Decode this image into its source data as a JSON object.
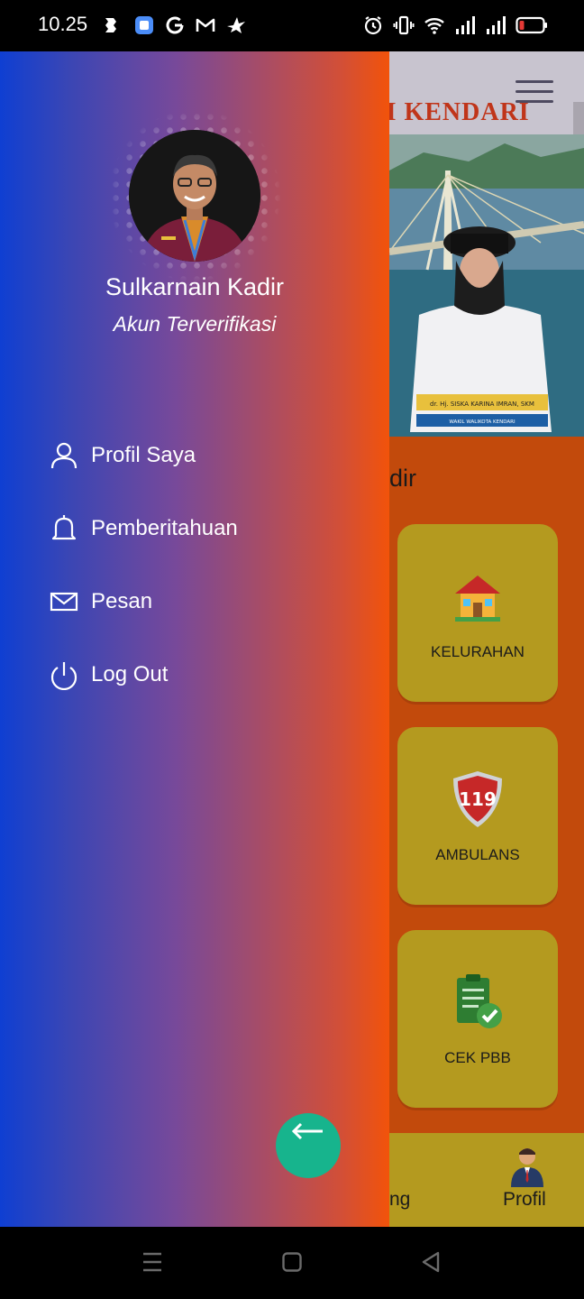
{
  "status_bar": {
    "time": "10.25",
    "left_icons": [
      "app-icon",
      "app-icon",
      "g-icon",
      "gmail-icon",
      "bird-icon"
    ],
    "right_icons": [
      "alarm-icon",
      "vibrate-icon",
      "wifi-icon",
      "signal-icon",
      "signal-icon",
      "battery-icon"
    ]
  },
  "background_app": {
    "header_title": "SI KENDARI",
    "banner_caption": "dr. Hj. SISKA KARINA IMRAN, SKM",
    "banner_subcaption": "WAKIL WALIKOTA KENDARI",
    "welcome_partial": "dir",
    "menu_cards": [
      {
        "label": "KELURAHAN",
        "icon": "house-icon"
      },
      {
        "label": "AMBULANS",
        "icon": "ambulance-119-icon"
      },
      {
        "label": "CEK PBB",
        "icon": "checklist-icon"
      }
    ],
    "bottom_nav": {
      "left_partial": "ng",
      "profile_label": "Profil"
    }
  },
  "drawer": {
    "name": "Sulkarnain Kadir",
    "status": "Akun Terverifikasi",
    "items": [
      {
        "label": "Profil Saya",
        "icon": "user-icon"
      },
      {
        "label": "Pemberitahuan",
        "icon": "bell-icon"
      },
      {
        "label": "Pesan",
        "icon": "mail-icon"
      },
      {
        "label": "Log Out",
        "icon": "power-icon"
      }
    ],
    "back_button_icon": "arrow-left-icon"
  },
  "colors": {
    "drawer_gradient_start": "#0f3fd2",
    "drawer_gradient_end": "#f2530a",
    "card_bg": "#b49a1f",
    "fab": "#17b48d",
    "app_bg": "#c24a0c"
  }
}
